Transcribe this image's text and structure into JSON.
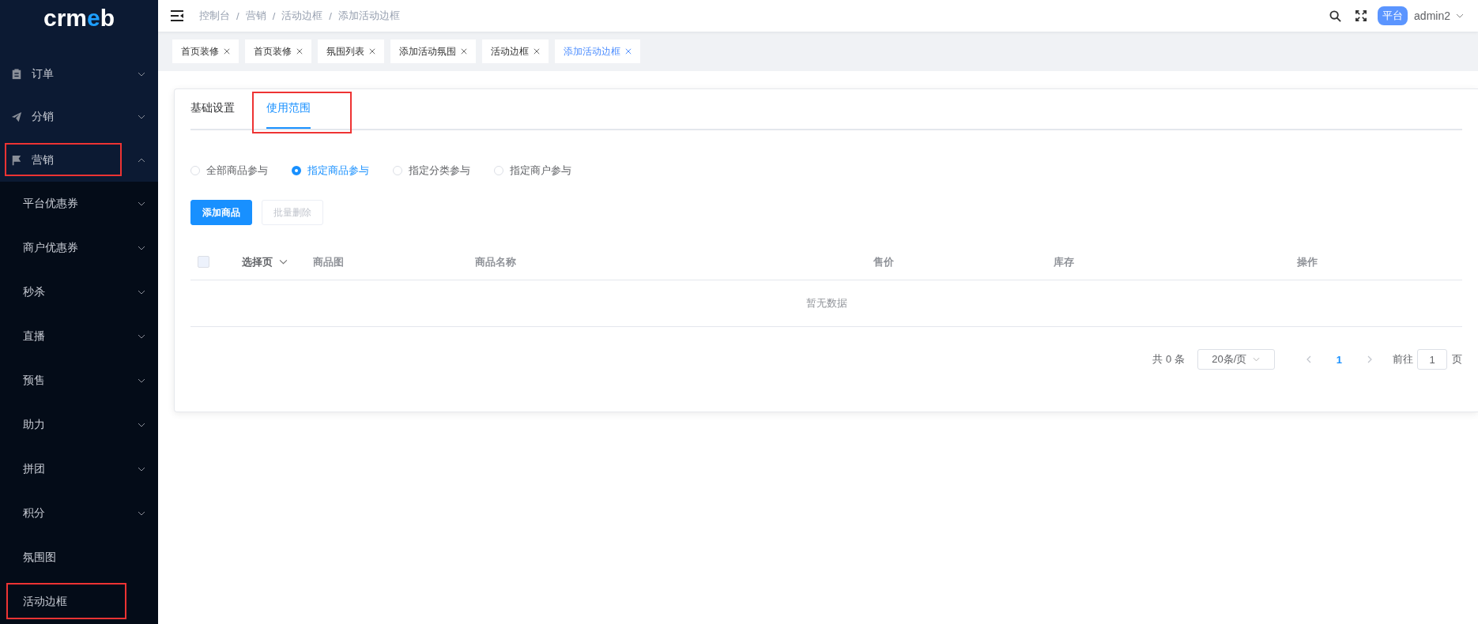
{
  "sidebar": {
    "logo": {
      "prefix": "crm",
      "accent": "e",
      "suffix": "b"
    },
    "items": [
      {
        "label": "订单",
        "expanded": false,
        "highlighted": false
      },
      {
        "label": "分销",
        "expanded": false,
        "highlighted": false
      },
      {
        "label": "营销",
        "expanded": true,
        "highlighted": true,
        "children": [
          {
            "label": "平台优惠券",
            "kind": "submenu",
            "highlighted": false
          },
          {
            "label": "商户优惠券",
            "kind": "submenu",
            "highlighted": false
          },
          {
            "label": "秒杀",
            "kind": "submenu",
            "highlighted": false
          },
          {
            "label": "直播",
            "kind": "submenu",
            "highlighted": false
          },
          {
            "label": "预售",
            "kind": "submenu",
            "highlighted": false
          },
          {
            "label": "助力",
            "kind": "submenu",
            "highlighted": false
          },
          {
            "label": "拼团",
            "kind": "submenu",
            "highlighted": false
          },
          {
            "label": "积分",
            "kind": "submenu",
            "highlighted": false
          },
          {
            "label": "氛围图",
            "kind": "link",
            "highlighted": false
          },
          {
            "label": "活动边框",
            "kind": "link",
            "highlighted": true
          }
        ]
      }
    ]
  },
  "header": {
    "breadcrumb": [
      {
        "label": "控制台"
      },
      {
        "separator": "/",
        "label": "营销"
      },
      {
        "separator": "/",
        "label": "活动边框"
      },
      {
        "separator": "/",
        "label": "添加活动边框"
      }
    ],
    "role_badge": "平台",
    "user": "admin2"
  },
  "tags": [
    {
      "label": "首页装修",
      "selected": false
    },
    {
      "label": "首页装修",
      "selected": false
    },
    {
      "label": "氛围列表",
      "selected": false
    },
    {
      "label": "添加活动氛围",
      "selected": false
    },
    {
      "label": "活动边框",
      "selected": false
    },
    {
      "label": "添加活动边框",
      "selected": true
    }
  ],
  "tabs": [
    {
      "label": "基础设置",
      "selected": false,
      "highlighted": false
    },
    {
      "label": "使用范围",
      "selected": true,
      "highlighted": true
    }
  ],
  "scope_options": [
    {
      "label": "全部商品参与",
      "selected": false
    },
    {
      "label": "指定商品参与",
      "selected": true
    },
    {
      "label": "指定分类参与",
      "selected": false
    },
    {
      "label": "指定商户参与",
      "selected": false
    }
  ],
  "buttons": [
    {
      "label": "添加商品",
      "kind": "primary",
      "disabled": false
    },
    {
      "label": "批量删除",
      "kind": "default",
      "disabled": true
    }
  ],
  "table": {
    "select_all": {
      "checked": false
    },
    "columns": [
      "选择页",
      "商品图",
      "商品名称",
      "售价",
      "库存",
      "操作"
    ],
    "empty_text": "暂无数据"
  },
  "pagination": {
    "total": "共 0 条",
    "page_size": "20条/页",
    "pages": [
      {
        "label": "1",
        "selected": true
      }
    ],
    "goto_label": "前往",
    "goto_value": "1",
    "goto_suffix": "页"
  }
}
